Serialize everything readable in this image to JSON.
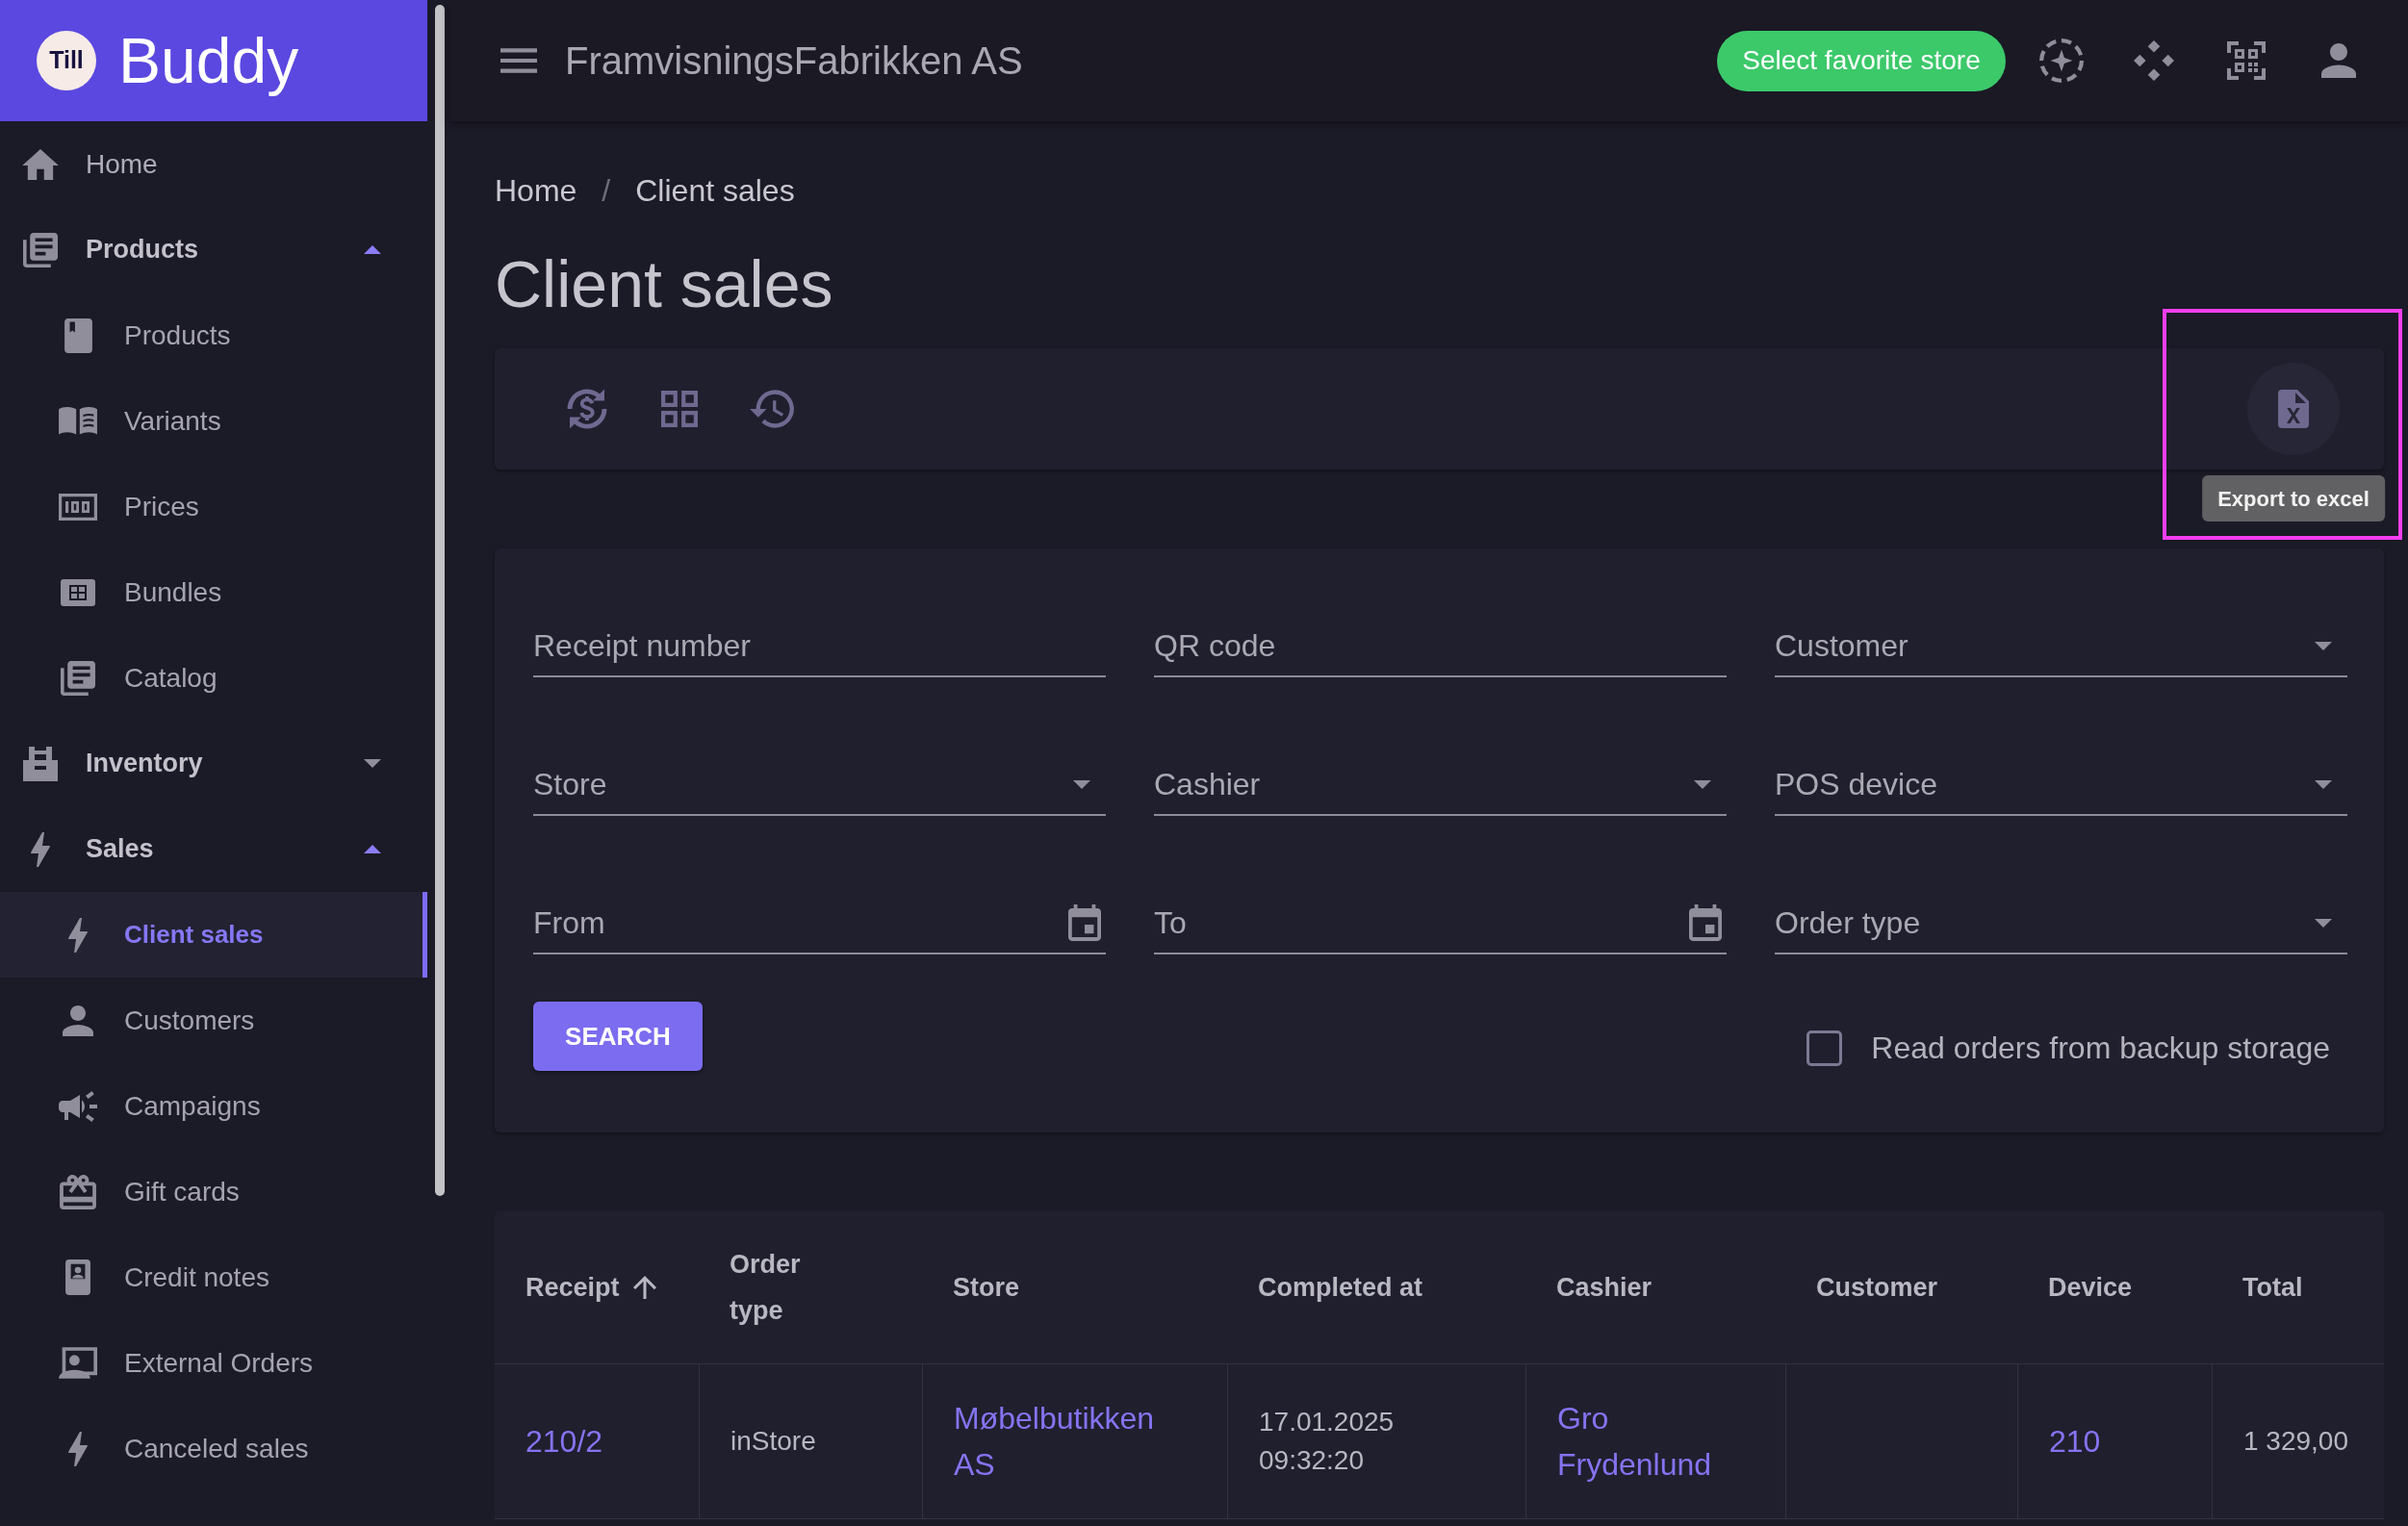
{
  "sidebar": {
    "logo": {
      "badge": "Till",
      "name": "Buddy"
    },
    "items": [
      {
        "kind": "link",
        "label": "Home",
        "selected": false
      },
      {
        "kind": "group",
        "label": "Products",
        "expanded": true,
        "selected": false,
        "children": [
          {
            "label": "Products",
            "selected": false
          },
          {
            "label": "Variants",
            "selected": false
          },
          {
            "label": "Prices",
            "selected": false
          },
          {
            "label": "Bundles",
            "selected": false
          },
          {
            "label": "Catalog",
            "selected": false
          }
        ]
      },
      {
        "kind": "group",
        "label": "Inventory",
        "expanded": false,
        "selected": false
      },
      {
        "kind": "group",
        "label": "Sales",
        "expanded": true,
        "selected": false,
        "children": [
          {
            "label": "Client sales",
            "selected": true
          },
          {
            "label": "Customers",
            "selected": false
          },
          {
            "label": "Campaigns",
            "selected": false
          },
          {
            "label": "Gift cards",
            "selected": false
          },
          {
            "label": "Credit notes",
            "selected": false
          },
          {
            "label": "External Orders",
            "selected": false
          },
          {
            "label": "Canceled sales",
            "selected": false
          }
        ]
      }
    ]
  },
  "top_bar": {
    "company": "FramvisningsFabrikken AS",
    "favorite_store_button": "Select favorite store"
  },
  "breadcrumb": {
    "items": [
      "Home",
      "Client sales"
    ],
    "separator": "/"
  },
  "page_title": "Client sales",
  "toolbar": {
    "export_button": {
      "tooltip": "Export to excel",
      "highlighted": true
    }
  },
  "filters": {
    "fields": [
      {
        "kind": "text",
        "placeholder": "Receipt number"
      },
      {
        "kind": "text",
        "placeholder": "QR code"
      },
      {
        "kind": "select",
        "placeholder": "Customer"
      },
      {
        "kind": "select",
        "placeholder": "Store"
      },
      {
        "kind": "select",
        "placeholder": "Cashier"
      },
      {
        "kind": "select",
        "placeholder": "POS device"
      },
      {
        "kind": "date",
        "placeholder": "From"
      },
      {
        "kind": "date",
        "placeholder": "To"
      },
      {
        "kind": "select",
        "placeholder": "Order type"
      }
    ],
    "search_button": "SEARCH",
    "backup_checkbox": {
      "label": "Read orders from backup storage",
      "checked": false
    }
  },
  "table": {
    "columns": [
      {
        "label": "Receipt",
        "sorted": true
      },
      {
        "label": "Order type",
        "sorted": false
      },
      {
        "label": "Store",
        "sorted": false
      },
      {
        "label": "Completed at",
        "sorted": false
      },
      {
        "label": "Cashier",
        "sorted": false
      },
      {
        "label": "Customer",
        "sorted": false
      },
      {
        "label": "Device",
        "sorted": false
      },
      {
        "label": "Total",
        "sorted": false
      }
    ],
    "rows": [
      {
        "cells": [
          {
            "text": "210/2",
            "link": true
          },
          {
            "text": "inStore",
            "link": false
          },
          {
            "text": "Møbelbutikken AS",
            "link": true
          },
          {
            "text": "17.01.2025 09:32:20",
            "link": false
          },
          {
            "text": "Gro Frydenlund",
            "link": true
          },
          null,
          {
            "text": "210",
            "link": true
          },
          {
            "text": "1 329,00",
            "link": false
          }
        ]
      }
    ]
  }
}
